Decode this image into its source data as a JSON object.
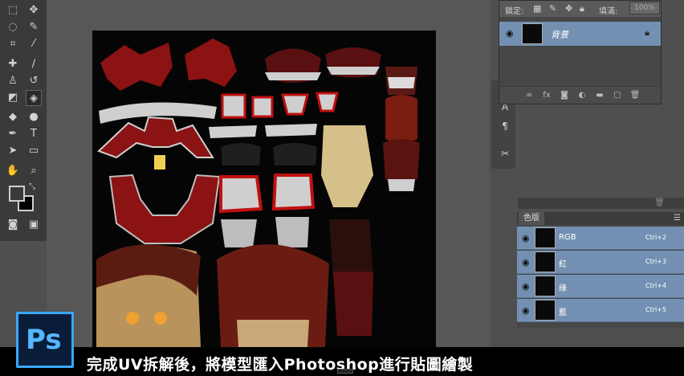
{
  "layers_panel": {
    "lock_label": "鎖定:",
    "fill_label": "填滿:",
    "fill_value": "100%",
    "layer_name": "背景"
  },
  "channels_panel": {
    "tab_label": "色版",
    "channels": [
      {
        "name": "RGB",
        "shortcut": "Ctrl+2"
      },
      {
        "name": "紅",
        "shortcut": "Ctrl+3"
      },
      {
        "name": "綠",
        "shortcut": "Ctrl+4"
      },
      {
        "name": "藍",
        "shortcut": "Ctrl+5"
      }
    ]
  },
  "caption": {
    "text": "完成UV拆解後，將模型匯入Photoshop進行貼圖繪製"
  },
  "logo": {
    "text": "Ps"
  },
  "colors": {
    "selection_blue": "#7390b3",
    "canvas_bg": "#050505",
    "brand_blue": "#38a8ff"
  }
}
